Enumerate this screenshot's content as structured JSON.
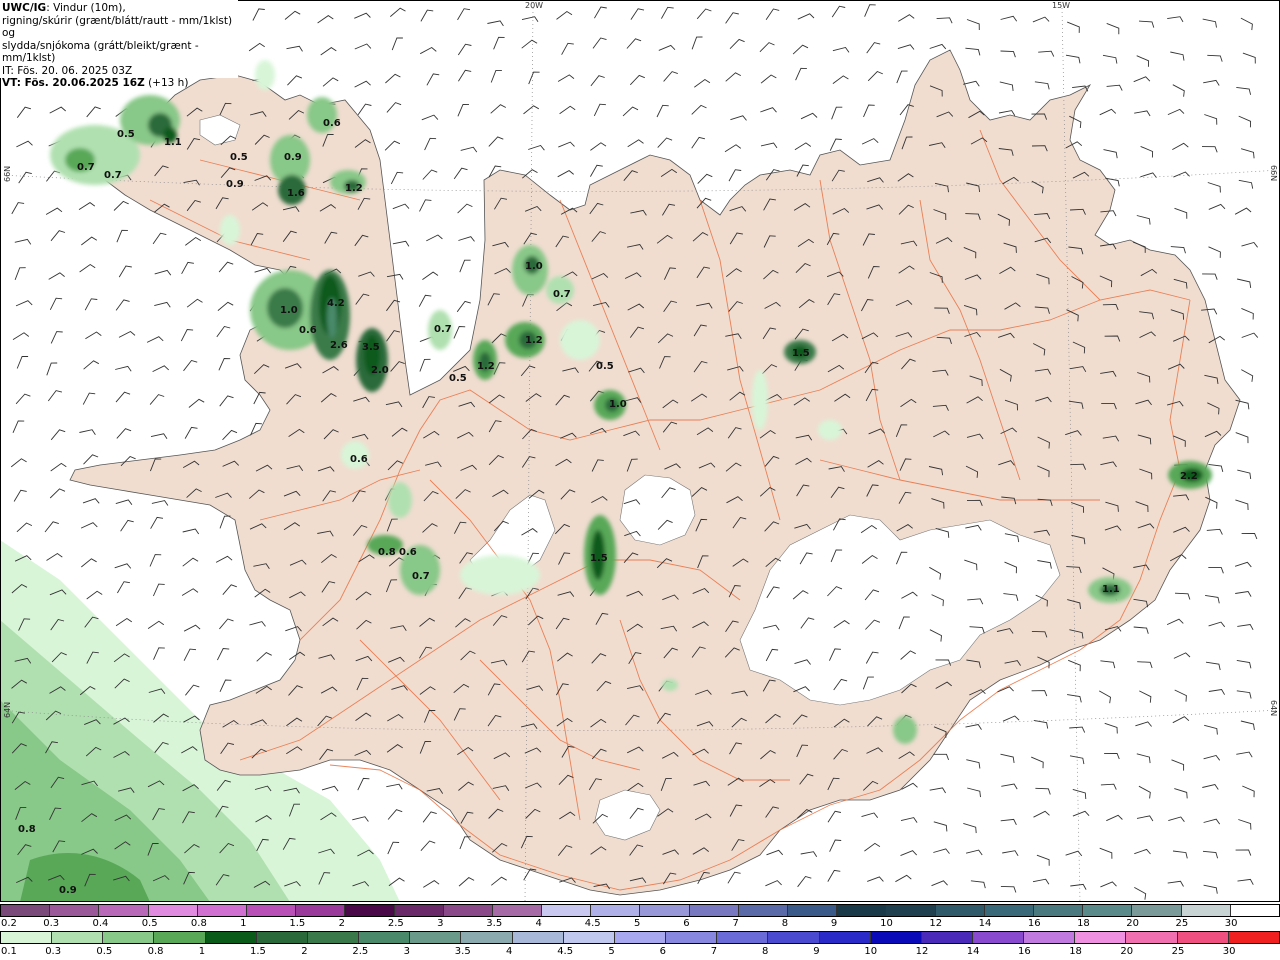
{
  "header": {
    "title_bold": "UWC/IG",
    "title_rest": ": Vindur (10m),",
    "line2": "rigning/skúrir (grænt/blátt/rautt - mm/1klst) og",
    "line3": "slydda/snjókoma (grátt/bleikt/grænt - mm/1klst)",
    "line4": "IT: Fös. 20. 06. 2025 03Z",
    "line5_bold": "VT: Fös. 20.06.2025 16Z",
    "line5_rest": " (+13 h)"
  },
  "graticule": {
    "lon_20w": "20W",
    "lon_15w": "15W",
    "lat_66n_left": "66N",
    "lat_66n_right": "66N",
    "lat_64n_left": "64N",
    "lat_64n_right": "64N"
  },
  "precip_labels": [
    {
      "text": "0.5"
    },
    {
      "text": "1.1"
    },
    {
      "text": "0.7"
    },
    {
      "text": "0.7"
    },
    {
      "text": "0.5"
    },
    {
      "text": "0.9"
    },
    {
      "text": "0.6"
    },
    {
      "text": "0.9"
    },
    {
      "text": "1.6"
    },
    {
      "text": "1.2"
    },
    {
      "text": "1.0"
    },
    {
      "text": "4.2"
    },
    {
      "text": "0.6"
    },
    {
      "text": "2.6"
    },
    {
      "text": "3.5"
    },
    {
      "text": "2.0"
    },
    {
      "text": "0.7"
    },
    {
      "text": "0.5"
    },
    {
      "text": "1.2"
    },
    {
      "text": "1.0"
    },
    {
      "text": "0.7"
    },
    {
      "text": "1.2"
    },
    {
      "text": "0.5"
    },
    {
      "text": "1.0"
    },
    {
      "text": "1.5"
    },
    {
      "text": "0.6"
    },
    {
      "text": "2.2"
    },
    {
      "text": "0.8"
    },
    {
      "text": "0.6"
    },
    {
      "text": "0.7"
    },
    {
      "text": "1.5"
    },
    {
      "text": "1.1"
    },
    {
      "text": "0.8"
    },
    {
      "text": "0.9"
    }
  ],
  "snow_scale": {
    "colors": [
      "#7a4a7a",
      "#9a5a9a",
      "#b86ab8",
      "#e08ae0",
      "#d070d0",
      "#b850b8",
      "#9a3a9a",
      "#4a0a4a",
      "#6a2a6a",
      "#8a4a8a",
      "#a66aa6",
      "#c8c8f0",
      "#b0b0e8",
      "#9898d8",
      "#7878c0",
      "#5a6aa8",
      "#3a5a8a",
      "#1a3a4a",
      "#204050",
      "#305a6a",
      "#3a6a7a",
      "#4a7a80",
      "#5a8a8a",
      "#7a9a9a",
      "#c8d4d4",
      "#ffffff"
    ],
    "labels": [
      "0.2",
      "0.3",
      "0.4",
      "0.5",
      "0.8",
      "1",
      "1.5",
      "2",
      "2.5",
      "3",
      "3.5",
      "4",
      "4.5",
      "5",
      "6",
      "7",
      "8",
      "9",
      "10",
      "12",
      "14",
      "16",
      "18",
      "20",
      "25",
      "30"
    ]
  },
  "rain_scale": {
    "colors": [
      "#d8f5d8",
      "#b0e0b0",
      "#88c888",
      "#58a858",
      "#0a5a1a",
      "#2a6a3a",
      "#3a7a4a",
      "#4a8a6a",
      "#6a9a8a",
      "#8aaab0",
      "#a8b8d8",
      "#c0c8f0",
      "#a8a8f0",
      "#8888e0",
      "#6a6ad8",
      "#4a4ad0",
      "#2a2ac8",
      "#0a0ab8",
      "#4a2ab8",
      "#8a4ad0",
      "#c07ae0",
      "#f090e0",
      "#f070b0",
      "#f05080",
      "#f02020"
    ],
    "labels": [
      "0.1",
      "0.3",
      "0.5",
      "0.8",
      "1",
      "1.5",
      "2",
      "2.5",
      "3",
      "3.5",
      "4",
      "4.5",
      "5",
      "6",
      "7",
      "8",
      "9",
      "10",
      "12",
      "14",
      "16",
      "18",
      "20",
      "25",
      "30"
    ]
  }
}
